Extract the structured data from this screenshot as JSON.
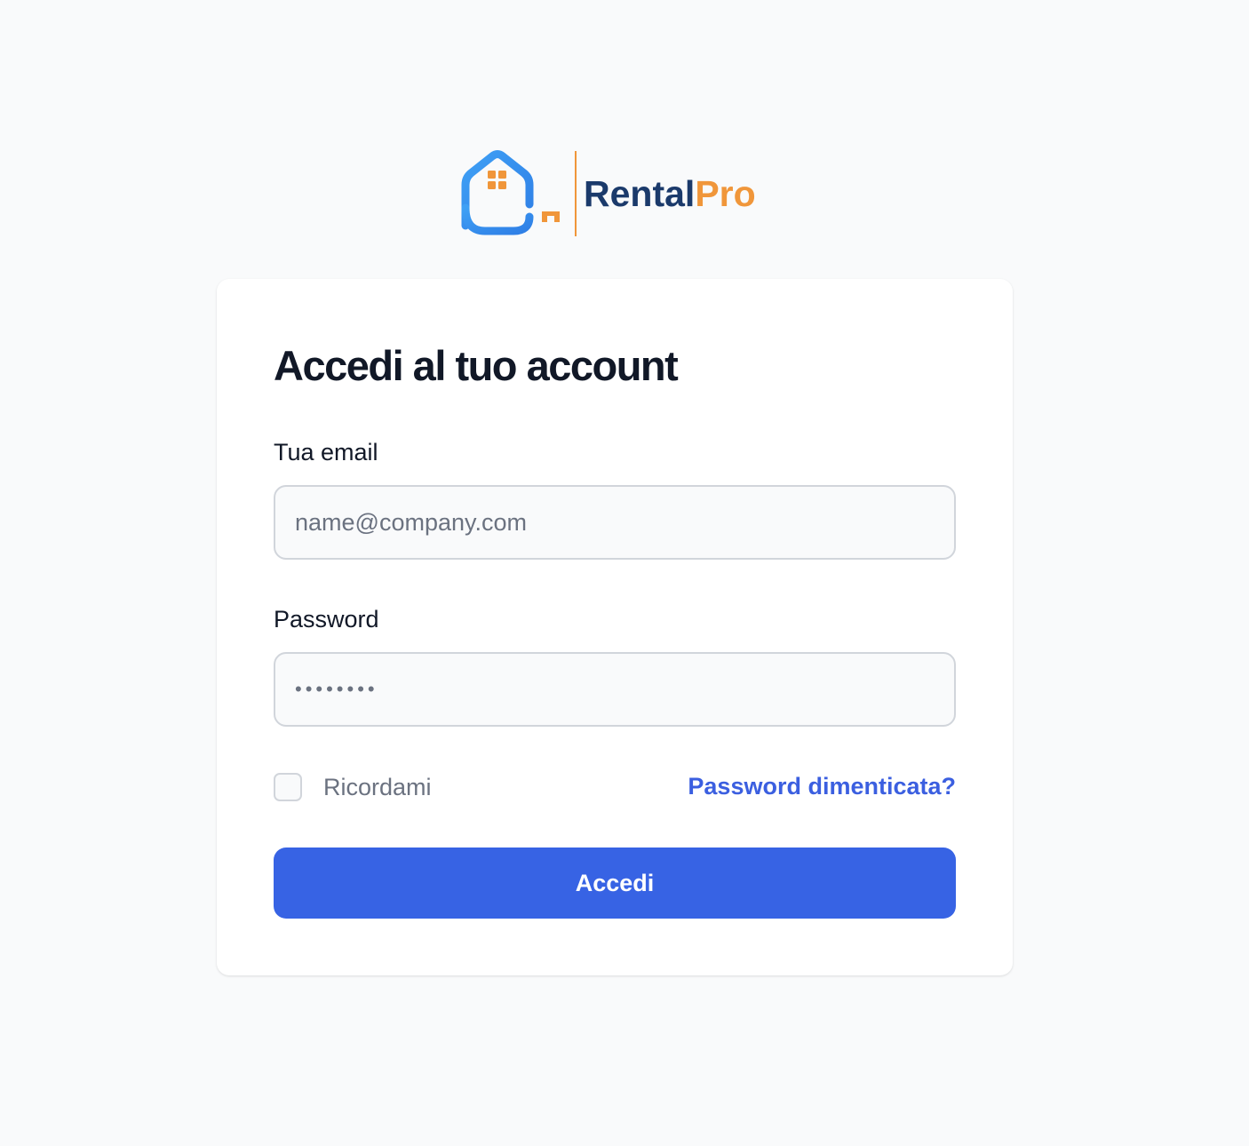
{
  "brand": {
    "name_part1": "Rental",
    "name_part2": "Pro",
    "color_primary": "#1b3a6b",
    "color_accent": "#f0963a",
    "logo_icon": "house-key-icon"
  },
  "login": {
    "title": "Accedi al tuo account",
    "email_label": "Tua email",
    "email_placeholder": "name@company.com",
    "email_value": "",
    "password_label": "Password",
    "password_placeholder": "••••••••",
    "password_value": "",
    "remember_label": "Ricordami",
    "remember_checked": false,
    "forgot_link": "Password dimenticata?",
    "submit_label": "Accedi"
  },
  "colors": {
    "background": "#f9fafb",
    "card": "#ffffff",
    "button": "#3763e4",
    "link": "#3b5fe0",
    "text": "#111827",
    "muted": "#6b7280"
  }
}
